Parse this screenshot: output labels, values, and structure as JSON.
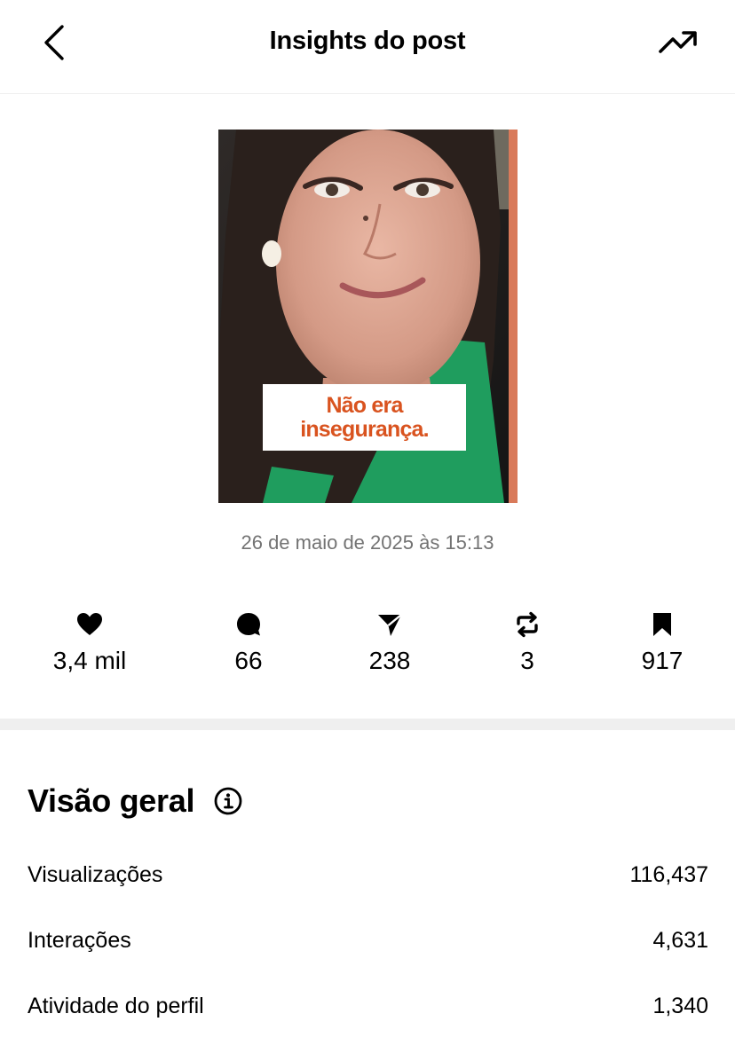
{
  "header": {
    "title": "Insights do post",
    "back_icon": "chevron-left-icon",
    "trend_icon": "trending-up-icon"
  },
  "post": {
    "caption_lines": [
      "Não era",
      "insegurança."
    ],
    "caption_color": "#d9531f",
    "accent_stripe_color": "#d97a5a",
    "date": "26 de maio de 2025 às 15:13"
  },
  "metrics": [
    {
      "icon": "heart-icon",
      "value": "3,4 mil"
    },
    {
      "icon": "comment-icon",
      "value": "66"
    },
    {
      "icon": "share-icon",
      "value": "238"
    },
    {
      "icon": "repost-icon",
      "value": "3"
    },
    {
      "icon": "bookmark-icon",
      "value": "917"
    }
  ],
  "overview": {
    "title": "Visão geral",
    "info_icon": "info-icon",
    "rows": [
      {
        "label": "Visualizações",
        "value": "116,437"
      },
      {
        "label": "Interações",
        "value": "4,631"
      },
      {
        "label": "Atividade do perfil",
        "value": "1,340"
      }
    ]
  }
}
